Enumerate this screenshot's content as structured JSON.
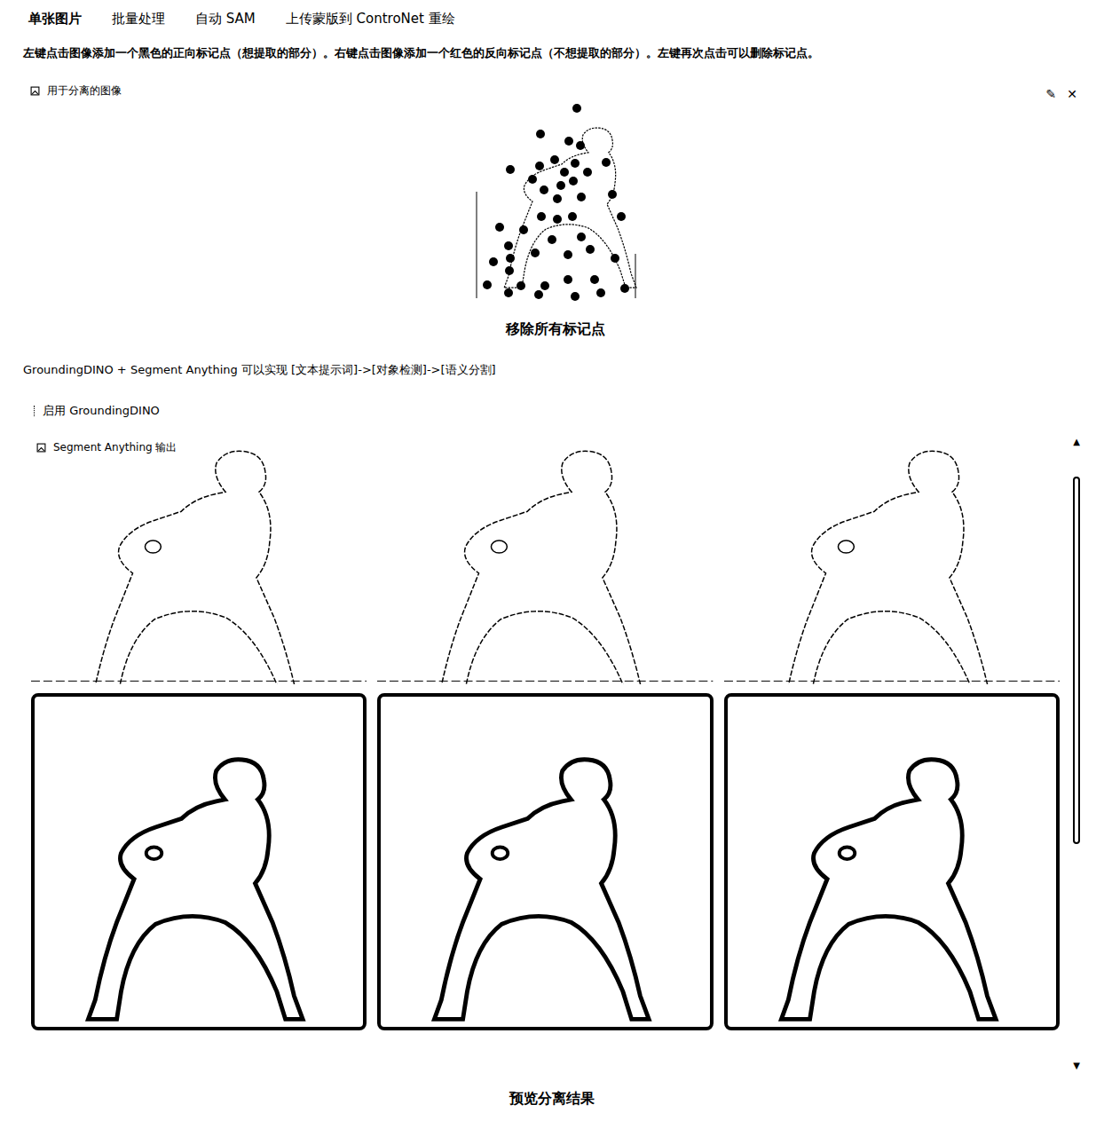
{
  "tabs": [
    {
      "label": "单张图片",
      "selected": true
    },
    {
      "label": "批量处理",
      "selected": false
    },
    {
      "label": "自动 SAM",
      "selected": false
    },
    {
      "label": "上传蒙版到 ControNet 重绘",
      "selected": false
    }
  ],
  "instructions": "左键点击图像添加一个黑色的正向标记点（想提取的部分）。右键点击图像添加一个红色的反向标记点（不想提取的部分）。左键再次点击可以删除标记点。",
  "input_panel": {
    "label": "用于分离的图像",
    "edit_icon": "✎",
    "close_icon": "✕",
    "markers": [
      {
        "positive": true
      },
      {
        "positive": true
      },
      {
        "positive": true
      },
      {
        "positive": true
      },
      {
        "positive": true
      },
      {
        "positive": true
      },
      {
        "positive": true
      },
      {
        "positive": true
      },
      {
        "positive": true
      },
      {
        "positive": true
      },
      {
        "positive": true
      },
      {
        "positive": true
      },
      {
        "positive": true
      },
      {
        "positive": true
      },
      {
        "positive": true
      },
      {
        "positive": true
      },
      {
        "positive": true
      },
      {
        "positive": true
      },
      {
        "positive": true
      },
      {
        "positive": true
      },
      {
        "positive": true
      },
      {
        "positive": true
      },
      {
        "positive": true
      },
      {
        "positive": true
      },
      {
        "positive": true
      },
      {
        "positive": true
      },
      {
        "positive": true
      },
      {
        "positive": true
      },
      {
        "positive": true
      },
      {
        "positive": true
      },
      {
        "positive": true
      },
      {
        "positive": true
      },
      {
        "positive": true
      },
      {
        "positive": true
      },
      {
        "positive": true
      },
      {
        "positive": true
      },
      {
        "positive": true
      },
      {
        "positive": true
      },
      {
        "positive": true
      },
      {
        "positive": true
      },
      {
        "positive": true
      },
      {
        "positive": true
      },
      {
        "positive": true
      },
      {
        "positive": true
      }
    ]
  },
  "remove_button": "移除所有标记点",
  "grounding_text": "GroundingDINO + Segment Anything 可以实现 [文本提示词]->[对象检测]->[语义分割]",
  "grounding_checkbox": {
    "label": "启用 GroundingDINO",
    "checked": false
  },
  "gallery": {
    "label": "Segment Anything 输出",
    "scroll_up": "▲",
    "scroll_down": "▼",
    "items": [
      {
        "kind": "sketch"
      },
      {
        "kind": "sketch"
      },
      {
        "kind": "sketch"
      },
      {
        "kind": "mask"
      },
      {
        "kind": "mask"
      },
      {
        "kind": "mask"
      }
    ]
  },
  "preview_button": "预览分离结果"
}
